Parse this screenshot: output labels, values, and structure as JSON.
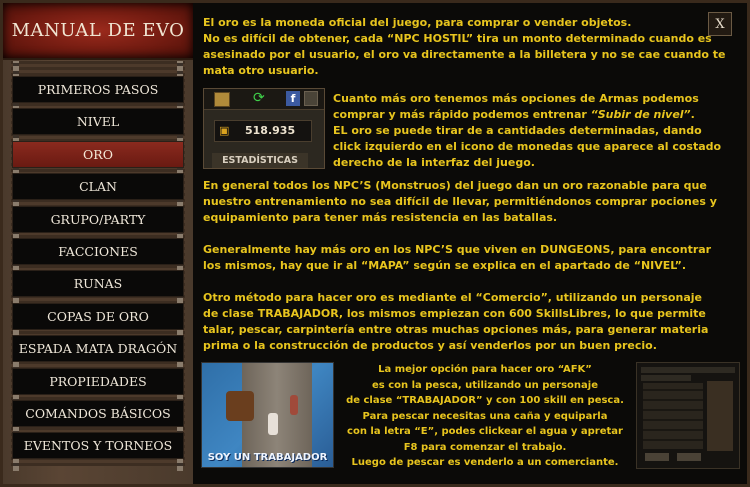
{
  "sidebar": {
    "title": "MANUAL DE EVO",
    "items": [
      {
        "label": "PRIMEROS PASOS"
      },
      {
        "label": "NIVEL"
      },
      {
        "label": "ORO"
      },
      {
        "label": "CLAN"
      },
      {
        "label": "GRUPO/PARTY"
      },
      {
        "label": "FACCIONES"
      },
      {
        "label": "RUNAS"
      },
      {
        "label": "COPAS DE ORO"
      },
      {
        "label": "ESPADA MATA DRAGÓN"
      },
      {
        "label": "PROPIEDADES"
      },
      {
        "label": "COMANDOS BÁSICOS"
      },
      {
        "label": "EVENTOS Y TORNEOS"
      }
    ],
    "active_index": 2
  },
  "close_label": "X",
  "content": {
    "p1_l1": "El oro es la moneda oficial del juego, para comprar o vender objetos.",
    "p1_l2": "No es difícil de obtener, cada “NPC HOSTIL” tira un monto determinado cuando es",
    "p1_l3": "asesinado por el usuario, el oro va directamente a la billetera y no se cae cuando te",
    "p1_l4": "mata otro usuario.",
    "p2_l1": "Cuanto más oro tenemos más opciones de Armas podemos",
    "p2_l2a": "comprar y más rápido podemos entrenar ",
    "p2_l2b": "“Subir de nivel”",
    "p2_l2c": ".",
    "p2_l3": "EL oro se puede tirar de a cantidades determinadas, dando",
    "p2_l4": "click izquierdo en el icono de monedas que aparece al costado",
    "p2_l5": "derecho de la interfaz del juego.",
    "p3_l1": "En general todos los NPC’S (Monstruos) del juego dan un oro razonable para que",
    "p3_l2": "nuestro entrenamiento no sea difícil de llevar, permitiéndonos comprar pociones y",
    "p3_l3": "equipamiento para tener más resistencia en las batallas.",
    "p4_l1": "Generalmente hay más oro en los NPC’S que viven en DUNGEONS, para encontrar",
    "p4_l2": "los mismos, hay que ir al “MAPA” según se explica en el apartado de “NIVEL”.",
    "p5_l1": "Otro método para hacer oro es mediante el “Comercio”, utilizando un personaje",
    "p5_l2": "de clase TRABAJADOR, los mismos empiezan con 600 SkillsLibres, lo que permite",
    "p5_l3": "talar, pescar, carpintería entre otras muchas opciones más, para generar materia",
    "p5_l4": "prima o la construcción de productos y así venderlos por un buen precio.",
    "p6_l1": "La mejor opción para hacer oro “AFK”",
    "p6_l2": "es con la pesca, utilizando un personaje",
    "p6_l3": "de clase “TRABAJADOR” y con 100 skill en pesca.",
    "p6_l4": "Para pescar necesitas una caña y equiparla",
    "p6_l5": "con la letra “E”, podes clickear el agua y apretar",
    "p6_l6": "F8 para comenzar el trabajo.",
    "p6_l7": "Luego de pescar es venderlo a un comerciante."
  },
  "stats_widget": {
    "gold_value": "518.935",
    "stats_label": "ESTADÍSTICAS",
    "icons": [
      "coin-icon",
      "refresh-icon",
      "facebook-icon"
    ]
  },
  "worker_image": {
    "caption": "SOY UN TRABAJADOR"
  },
  "colors": {
    "text": "#e8c51e",
    "active_item": "#7a2216",
    "background": "#0b0a08"
  }
}
